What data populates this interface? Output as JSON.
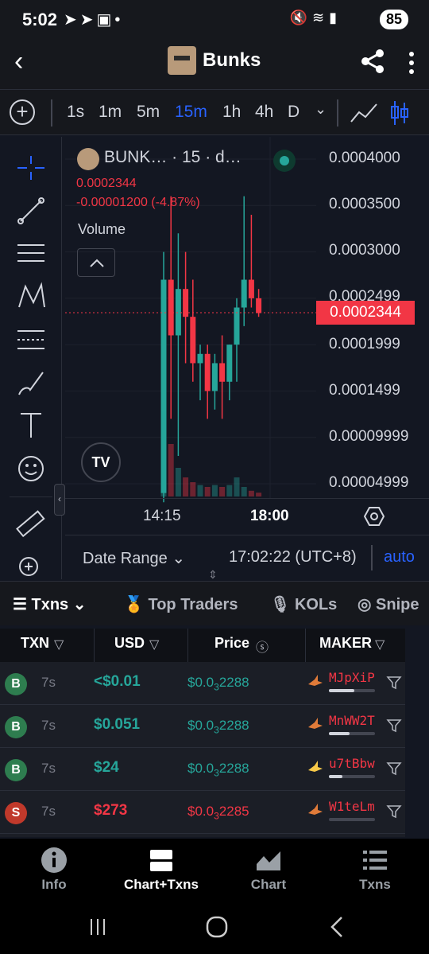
{
  "status": {
    "time": "5:02",
    "battery": "85"
  },
  "header": {
    "title": "Bunks"
  },
  "timeframes": [
    "1s",
    "1m",
    "5m",
    "15m",
    "1h",
    "4h",
    "D"
  ],
  "active_timeframe": "15m",
  "chart_legend": {
    "symbol": "BUNK… · 15 · d…",
    "price": "0.0002344",
    "change": "-0.00001200 (-4.87%)",
    "volume_label": "Volume"
  },
  "chart_data": {
    "type": "candlestick",
    "y_ticks": [
      "0.0004000",
      "0.0003500",
      "0.0003000",
      "0.0002499",
      "0.0001999",
      "0.0001499",
      "0.00009999",
      "0.00004999"
    ],
    "x_ticks": [
      "14:15",
      "18:00"
    ],
    "last_price": "0.0002344",
    "candles": [
      {
        "o": 4e-05,
        "h": 0.0003,
        "l": 3e-05,
        "c": 0.00027,
        "dir": "up"
      },
      {
        "o": 0.00027,
        "h": 0.00036,
        "l": 0.00012,
        "c": 0.00021,
        "dir": "down"
      },
      {
        "o": 0.00021,
        "h": 0.00032,
        "l": 8e-05,
        "c": 0.00026,
        "dir": "up"
      },
      {
        "o": 0.00026,
        "h": 0.0003,
        "l": 0.00018,
        "c": 0.00023,
        "dir": "down"
      },
      {
        "o": 0.00023,
        "h": 0.00027,
        "l": 0.00016,
        "c": 0.00018,
        "dir": "down"
      },
      {
        "o": 0.00018,
        "h": 0.0002,
        "l": 0.00014,
        "c": 0.00019,
        "dir": "up"
      },
      {
        "o": 0.00019,
        "h": 0.0002,
        "l": 0.00012,
        "c": 0.00015,
        "dir": "down"
      },
      {
        "o": 0.00015,
        "h": 0.00019,
        "l": 0.00013,
        "c": 0.00018,
        "dir": "up"
      },
      {
        "o": 0.00018,
        "h": 0.00021,
        "l": 0.00012,
        "c": 0.00016,
        "dir": "down"
      },
      {
        "o": 0.00016,
        "h": 0.0002,
        "l": 0.00014,
        "c": 0.0002,
        "dir": "up"
      },
      {
        "o": 0.0002,
        "h": 0.00025,
        "l": 0.00016,
        "c": 0.00024,
        "dir": "up"
      },
      {
        "o": 0.00024,
        "h": 0.00036,
        "l": 0.00022,
        "c": 0.00027,
        "dir": "up"
      },
      {
        "o": 0.00027,
        "h": 0.00034,
        "l": 0.00024,
        "c": 0.00025,
        "dir": "down"
      },
      {
        "o": 0.00025,
        "h": 0.00026,
        "l": 0.00023,
        "c": 0.000234,
        "dir": "down"
      }
    ],
    "volumes": [
      0.9,
      0.55,
      0.3,
      0.2,
      0.15,
      0.12,
      0.1,
      0.12,
      0.1,
      0.12,
      0.2,
      0.1,
      0.06,
      0.04
    ]
  },
  "date_range": {
    "label": "Date Range",
    "time": "17:02:22 (UTC+8)",
    "auto": "auto"
  },
  "tabs": [
    {
      "label": "Txns"
    },
    {
      "label": "Top Traders"
    },
    {
      "label": "KOLs"
    },
    {
      "label": "Snipe"
    }
  ],
  "table": {
    "headers": [
      "TXN",
      "USD",
      "Price",
      "MAKER"
    ],
    "rows": [
      {
        "type": "B",
        "age": "7s",
        "usd": "<$0.01",
        "price_prefix": "$0.0",
        "price_sub": "3",
        "price_rest": "2288",
        "maker": "MJpXiP",
        "maker_fill": 0.55
      },
      {
        "type": "B",
        "age": "7s",
        "usd": "$0.051",
        "price_prefix": "$0.0",
        "price_sub": "3",
        "price_rest": "2288",
        "maker": "MnWW2T",
        "maker_fill": 0.45
      },
      {
        "type": "B",
        "age": "7s",
        "usd": "$24",
        "price_prefix": "$0.0",
        "price_sub": "3",
        "price_rest": "2288",
        "maker": "u7tBbw",
        "maker_fill": 0.3
      },
      {
        "type": "S",
        "age": "7s",
        "usd": "$273",
        "price_prefix": "$0.0",
        "price_sub": "3",
        "price_rest": "2285",
        "maker": "W1teLm",
        "maker_fill": 0.0
      }
    ]
  },
  "bottom_nav": [
    {
      "label": "Info"
    },
    {
      "label": "Chart+Txns"
    },
    {
      "label": "Chart"
    },
    {
      "label": "Txns"
    }
  ],
  "colors": {
    "up": "#26a69a",
    "down": "#f23645",
    "accent": "#2962ff",
    "bg": "#131722"
  }
}
